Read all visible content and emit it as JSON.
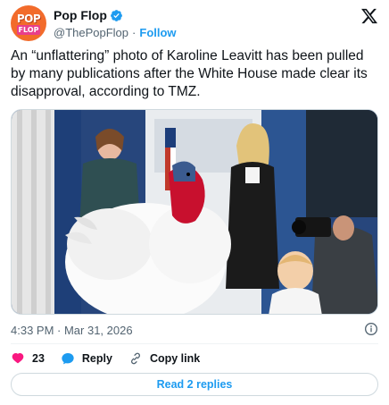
{
  "author": {
    "avatar_text_top": "POP",
    "avatar_text_bottom": "FLOP",
    "display_name": "Pop Flop",
    "handle": "@ThePopFlop",
    "separator": "·",
    "follow_label": "Follow",
    "verified_color": "#1d9bf0"
  },
  "tweet": {
    "text": "An “unflattering” photo of Karoline Leavitt has been pulled by many publications after the White House made clear its disapproval, according to TMZ.",
    "timestamp": "4:33 PM · Mar 31, 2026"
  },
  "actions": {
    "like_count": "23",
    "reply_label": "Reply",
    "copy_link_label": "Copy link",
    "read_replies_label": "Read 2 replies"
  },
  "colors": {
    "accent": "#1d9bf0",
    "like": "#f91880",
    "muted": "#536471",
    "avatar_bg": "#f26b2b"
  },
  "icons": {
    "verified": "verified-badge-icon",
    "x_logo": "x-logo-icon",
    "info": "info-icon",
    "like": "heart-icon",
    "reply": "reply-bubble-icon",
    "copy_link": "link-icon"
  }
}
